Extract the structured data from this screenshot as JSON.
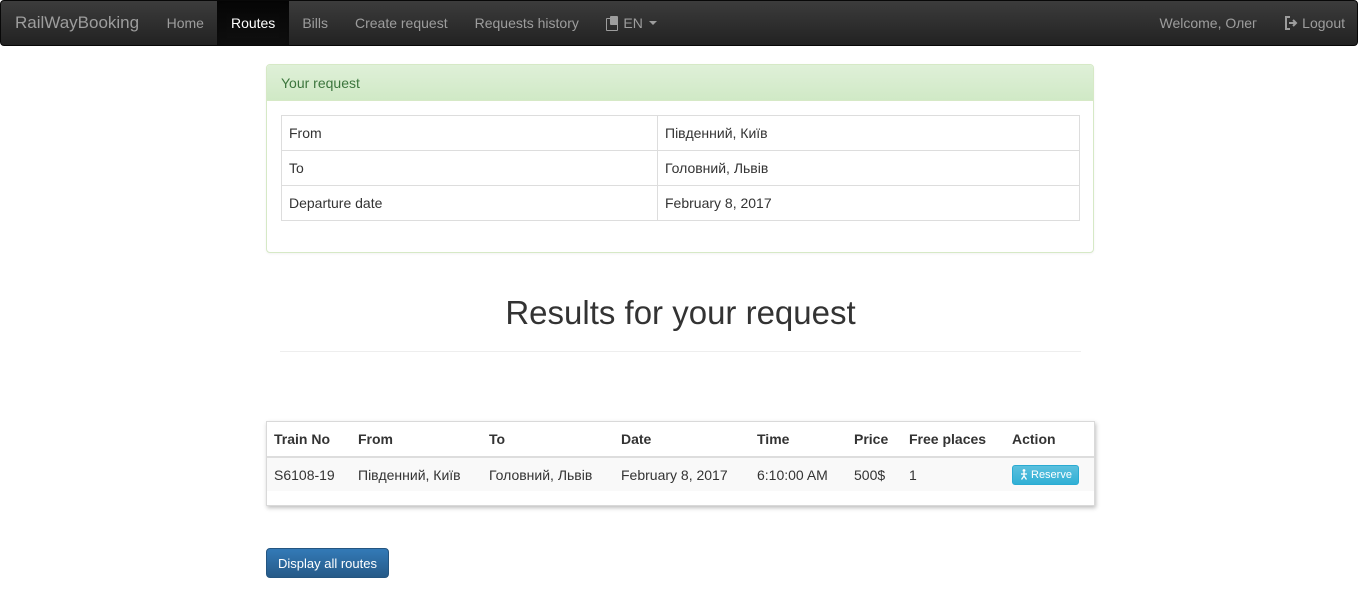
{
  "navbar": {
    "brand": "RailWayBooking",
    "items": [
      {
        "label": "Home",
        "active": false
      },
      {
        "label": "Routes",
        "active": true
      },
      {
        "label": "Bills",
        "active": false
      },
      {
        "label": "Create request",
        "active": false
      },
      {
        "label": "Requests history",
        "active": false
      }
    ],
    "language": "EN",
    "welcome": "Welcome, Олег",
    "logout": "Logout"
  },
  "request_panel": {
    "title": "Your request",
    "rows": [
      {
        "label": "From",
        "value": "Південний, Київ"
      },
      {
        "label": "To",
        "value": "Головний, Львів"
      },
      {
        "label": "Departure date",
        "value": "February 8, 2017"
      }
    ]
  },
  "results": {
    "title": "Results for your request",
    "columns": [
      "Train No",
      "From",
      "To",
      "Date",
      "Time",
      "Price",
      "Free places",
      "Action"
    ],
    "rows": [
      {
        "train_no": "S6108-19",
        "from": "Південний, Київ",
        "to": "Головний, Львів",
        "date": "February 8, 2017",
        "time": "6:10:00 AM",
        "price": "500$",
        "free_places": "1",
        "action": "Reserve"
      }
    ]
  },
  "display_all_label": "Display all routes",
  "colors": {
    "navbar_bg": "#222222",
    "panel_success": "#dff0d8",
    "info_button": "#5bc0de",
    "primary_button": "#337ab7"
  }
}
